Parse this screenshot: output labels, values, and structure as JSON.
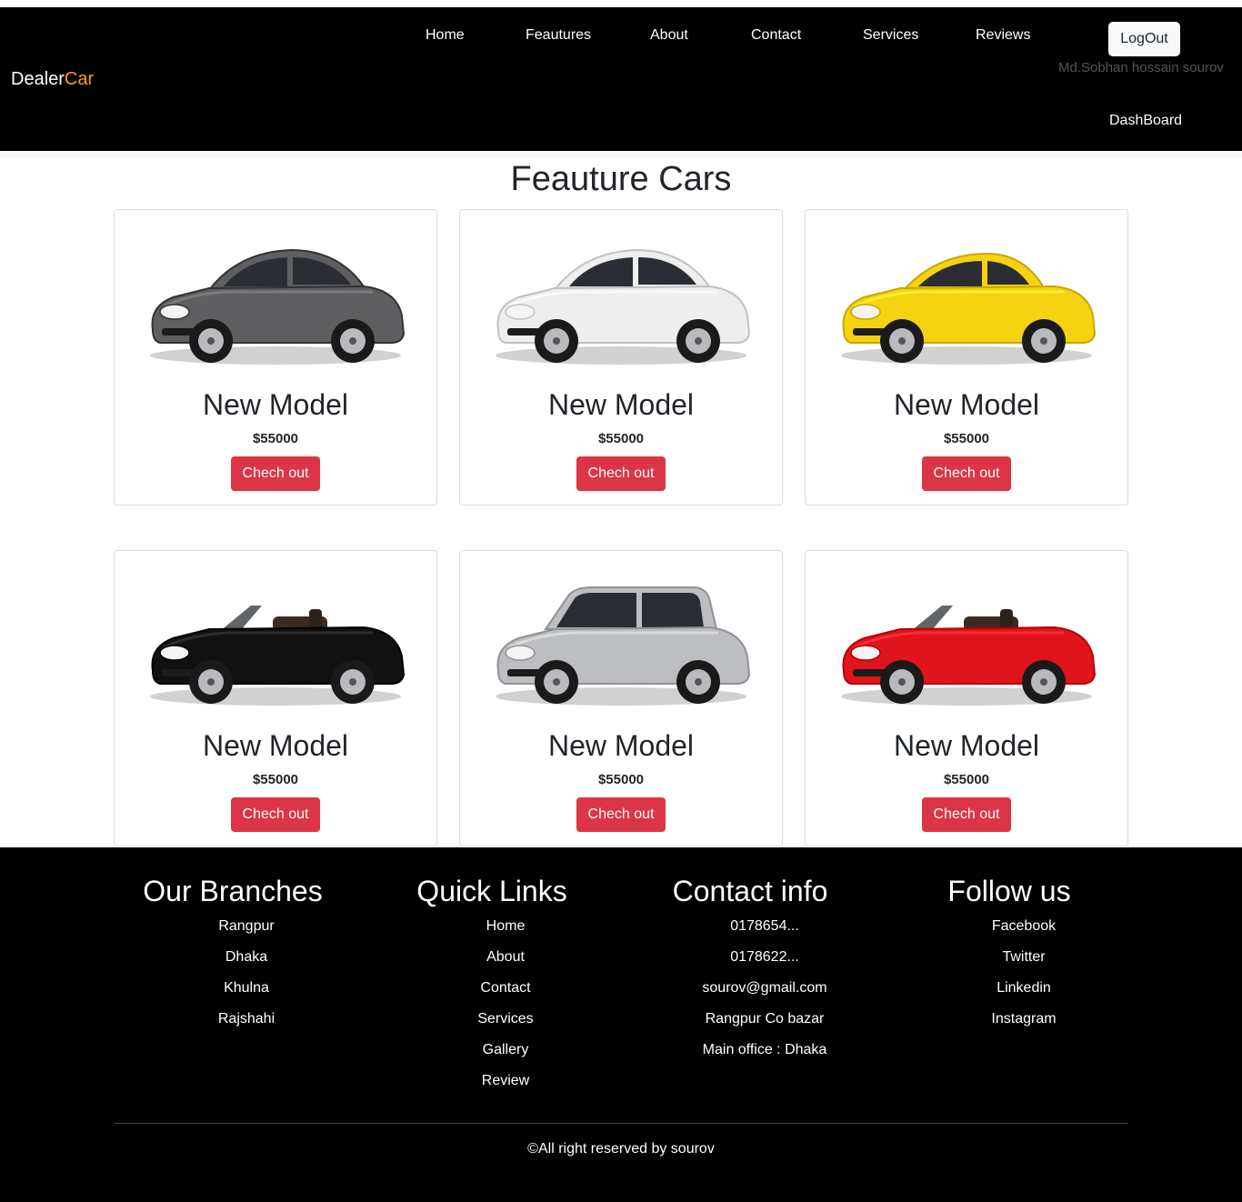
{
  "navbar": {
    "brand_part1": "Dealer",
    "brand_part2": "Car",
    "links": [
      "Home",
      "Feautures",
      "About",
      "Contact",
      "Services",
      "Reviews"
    ],
    "logout_label": "LogOut",
    "user_name": "Md.Sobhan hossain sourov",
    "dashboard_label": "DashBoard"
  },
  "section": {
    "title": "Feauture Cars"
  },
  "cards": [
    {
      "title": "New Model",
      "price": "$55000",
      "button": "Chech out",
      "car_color": "#5f5f62",
      "car_type": "sedan"
    },
    {
      "title": "New Model",
      "price": "$55000",
      "button": "Chech out",
      "car_color": "#eeeeee",
      "car_type": "sedan"
    },
    {
      "title": "New Model",
      "price": "$55000",
      "button": "Chech out",
      "car_color": "#f5d311",
      "car_type": "coupe"
    },
    {
      "title": "New Model",
      "price": "$55000",
      "button": "Chech out",
      "car_color": "#111111",
      "car_type": "convertible"
    },
    {
      "title": "New Model",
      "price": "$55000",
      "button": "Chech out",
      "car_color": "#bcbec1",
      "car_type": "suv"
    },
    {
      "title": "New Model",
      "price": "$55000",
      "button": "Chech out",
      "car_color": "#e0141c",
      "car_type": "convertible"
    }
  ],
  "footer": {
    "branches": {
      "title": "Our Branches",
      "items": [
        "Rangpur",
        "Dhaka",
        "Khulna",
        "Rajshahi"
      ]
    },
    "quick_links": {
      "title": "Quick Links",
      "items": [
        "Home",
        "About",
        "Contact",
        "Services",
        "Gallery",
        "Review"
      ]
    },
    "contact": {
      "title": "Contact info",
      "items": [
        "0178654...",
        "0178622...",
        "sourov@gmail.com",
        "Rangpur Co bazar",
        "Main office : Dhaka"
      ]
    },
    "follow": {
      "title": "Follow us",
      "items": [
        "Facebook",
        "Twitter",
        "Linkedin",
        "Instagram"
      ]
    },
    "copyright": "©All right reserved by sourov"
  },
  "colors": {
    "navbar_bg": "#000000",
    "brand_accent": "#f0a500",
    "button_danger": "#dc3545",
    "footer_bg": "#000000"
  }
}
